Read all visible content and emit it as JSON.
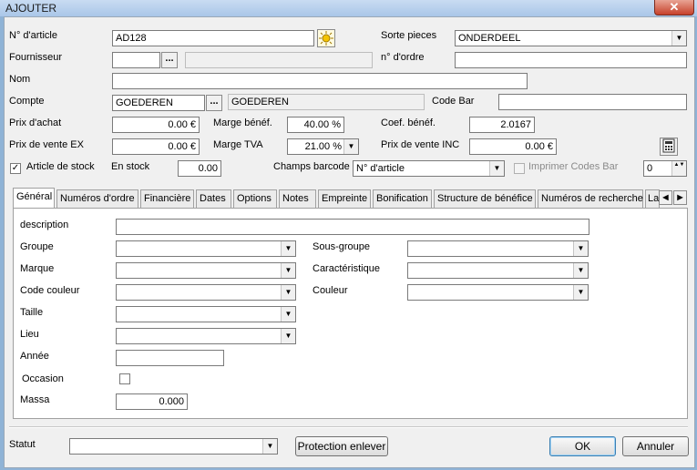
{
  "window": {
    "title": "AJOUTER",
    "close_glyph": "✕"
  },
  "form": {
    "article_no_label": "N° d'article",
    "article_no_value": "AD128",
    "sort_label": "Sorte pieces",
    "sort_value": "ONDERDEEL",
    "supplier_label": "Fournisseur",
    "supplier_value": "",
    "order_no_label": "n° d'ordre",
    "order_no_value": "",
    "name_label": "Nom",
    "name_value": "",
    "account_label": "Compte",
    "account_value": "GOEDEREN",
    "account_name": "GOEDEREN",
    "barcode_label": "Code Bar",
    "barcode_value": "",
    "purchase_label": "Prix d'achat",
    "purchase_value": "0.00 €",
    "margin_label": "Marge bénéf.",
    "margin_value": "40.00 %",
    "coef_label": "Coef. bénéf.",
    "coef_value": "2.0167",
    "sale_ex_label": "Prix de vente EX",
    "sale_ex_value": "0.00 €",
    "vat_label": "Marge TVA",
    "vat_value": "21.00 %",
    "sale_inc_label": "Prix de vente INC",
    "sale_inc_value": "0.00 €",
    "stock_article_label": "Article de stock",
    "stock_article_checked": "✓",
    "in_stock_label": "En stock",
    "in_stock_value": "0.00",
    "barcode_field_label": "Champs barcode",
    "barcode_field_value": "N° d'article",
    "print_barcodes_label": "Imprimer Codes Bar",
    "print_count_value": "0",
    "dots": "..."
  },
  "tabs": [
    {
      "label": "Général"
    },
    {
      "label": "Numéros d'ordre"
    },
    {
      "label": "Financière"
    },
    {
      "label": "Dates"
    },
    {
      "label": "Options"
    },
    {
      "label": "Notes"
    },
    {
      "label": "Empreinte"
    },
    {
      "label": "Bonification"
    },
    {
      "label": "Structure de bénéfice"
    },
    {
      "label": "Numéros de recherche"
    },
    {
      "label": "La"
    }
  ],
  "general": {
    "description_label": "description",
    "group_label": "Groupe",
    "subgroup_label": "Sous-groupe",
    "brand_label": "Marque",
    "characteristic_label": "Caractéristique",
    "color_code_label": "Code couleur",
    "color_label": "Couleur",
    "size_label": "Taille",
    "place_label": "Lieu",
    "year_label": "Année",
    "occasion_label": "Occasion",
    "mass_label": "Massa",
    "mass_value": "0.000"
  },
  "footer": {
    "status_label": "Statut",
    "protection_button": "Protection enlever",
    "ok_button": "OK",
    "cancel_button": "Annuler"
  },
  "icons": {
    "dropdown": "▼",
    "tab_left": "◀",
    "tab_right": "▶",
    "spin": "▲▼"
  }
}
